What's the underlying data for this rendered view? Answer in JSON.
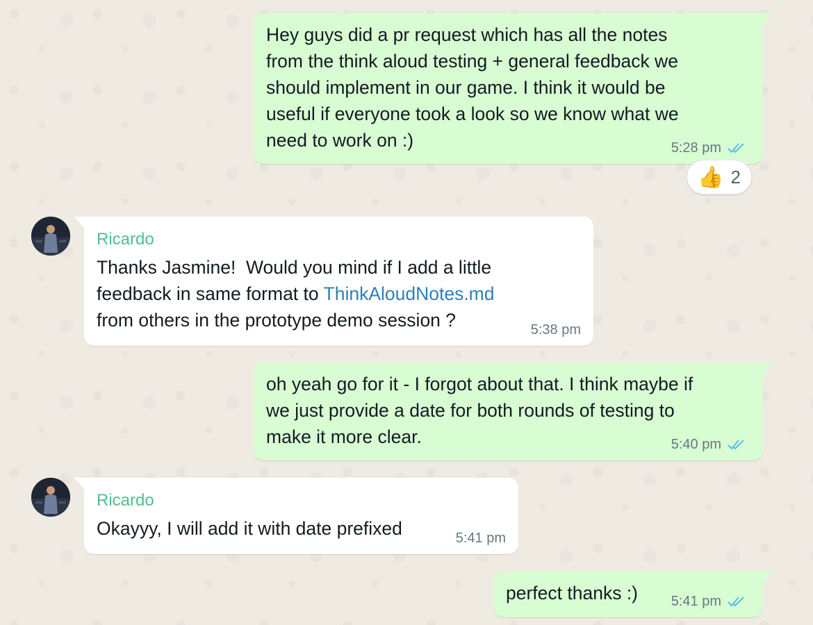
{
  "messages": [
    {
      "text": "Hey guys did a pr request which has all the notes\nfrom the think aloud testing + general feedback we\nshould implement in our game. I think it would be\nuseful if everyone took a look so we know what we\nneed to work on :)",
      "time": "5:28 pm",
      "ticks_icon": "double-check-read-icon"
    },
    {
      "sender": "Ricardo",
      "text_before": "Thanks Jasmine!  Would you mind if I add a little\nfeedback in same format to ",
      "link": "ThinkAloudNotes.md",
      "text_after": "\nfrom others in the prototype demo session ?",
      "time": "5:38 pm"
    },
    {
      "text": "oh yeah go for it - I forgot about that. I think maybe if\nwe just provide a date for both rounds of testing to\nmake it more clear.",
      "time": "5:40 pm",
      "ticks_icon": "double-check-read-icon"
    },
    {
      "sender": "Ricardo",
      "text": "Okayyy, I will add it with date prefixed",
      "time": "5:41 pm"
    },
    {
      "text": "perfect thanks :)",
      "time": "5:41 pm",
      "ticks_icon": "double-check-read-icon"
    }
  ],
  "reaction": {
    "emoji": "👍",
    "count": "2"
  },
  "colors": {
    "outgoing": "#d9fdd3",
    "incoming": "#ffffff",
    "sender_name": "#4fbf8c",
    "link": "#2f7fb8",
    "read_ticks": "#53bdeb",
    "background": "#efeae2"
  }
}
